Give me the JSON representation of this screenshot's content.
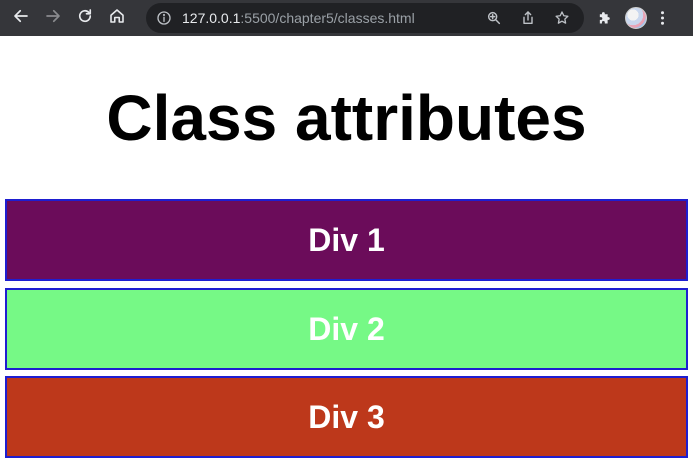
{
  "browser": {
    "url_host": "127.0.0.1",
    "url_rest": ":5500/chapter5/classes.html",
    "icons": {
      "back": "arrow-left-icon",
      "forward": "arrow-right-icon",
      "reload": "reload-icon",
      "home": "home-icon",
      "info": "info-icon",
      "zoom": "zoom-icon",
      "share": "share-icon",
      "bookmark": "star-icon",
      "extensions": "puzzle-icon",
      "menu": "kebab-menu-icon"
    },
    "colors": {
      "toolbar": "#35363a",
      "omnibox": "#202124"
    }
  },
  "page": {
    "heading": "Class attributes",
    "divs": [
      {
        "label": "Div 1",
        "color": "#6b0c5a"
      },
      {
        "label": "Div 2",
        "color": "#76f986"
      },
      {
        "label": "Div 3",
        "color": "#bd381b"
      }
    ],
    "border_color": "#1e1ed0"
  }
}
